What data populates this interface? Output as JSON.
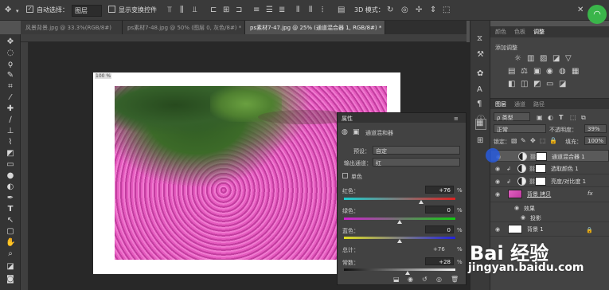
{
  "options_bar": {
    "auto_select_label": "自动选择：",
    "auto_select_value": "图层",
    "show_transform_label": "显示变换控件",
    "mode_label": "3D 模式："
  },
  "tabs": [
    {
      "label": "风景背景.jpg @ 33.3%(RGB/8#)"
    },
    {
      "label": "ps素材7-48.jpg @ 50% (图层 0, 灰色/8#) *"
    },
    {
      "label": "ps素材7-47.jpg @ 25% (通道混合器 1, RGB/8#) *"
    }
  ],
  "doc_corner_label": "100 %",
  "properties": {
    "title": "属性",
    "adj_name": "通道混和器",
    "preset_label": "预设：",
    "preset_value": "自定",
    "output_label": "输出通道：",
    "output_value": "红",
    "mono_label": "单色",
    "red_label": "红色：",
    "red_value": "+76",
    "green_label": "绿色：",
    "green_value": "0",
    "blue_label": "蓝色：",
    "blue_value": "0",
    "total_label": "总计：",
    "total_value": "+76",
    "const_label": "常数：",
    "const_value": "+28",
    "percent": "%"
  },
  "slider_levels": {
    "red": 76,
    "green": 0,
    "blue": 0,
    "constant": 28
  },
  "adjustments_panel": {
    "tabs": [
      "颜色",
      "色板",
      "调整"
    ],
    "heading": "添加调整"
  },
  "layers_panel": {
    "tabs": [
      "图层",
      "通道",
      "路径"
    ],
    "kind_label": "ρ 类型",
    "blend_mode": "正常",
    "opacity_label": "不透明度：",
    "opacity_value": "39%",
    "lock_label": "锁定：",
    "fill_label": "填充：",
    "fill_value": "100%",
    "layers": [
      {
        "name": "通道混合器 1"
      },
      {
        "name": "选取颜色 1"
      },
      {
        "name": "亮度/对比度 1"
      },
      {
        "name": "背景 拷贝"
      },
      {
        "name": "效果"
      },
      {
        "name": "投影"
      },
      {
        "name": "背景 1"
      }
    ],
    "fx_label": "fx"
  },
  "watermark": {
    "brand": "Bai 经验",
    "url": "jingyan.baidu.com"
  }
}
